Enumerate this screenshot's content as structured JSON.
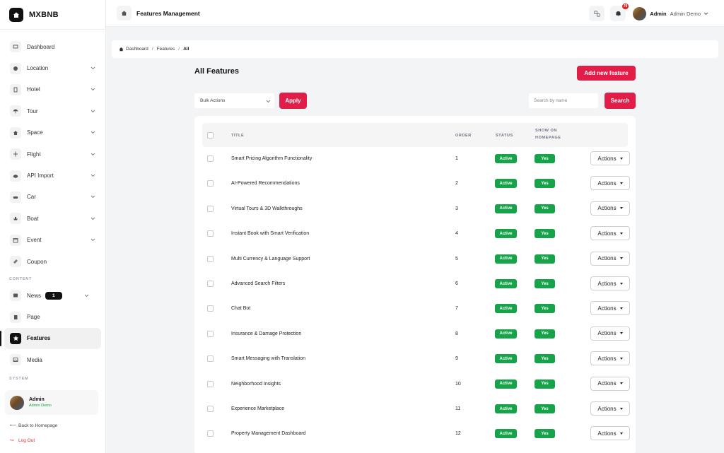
{
  "brand": {
    "name": "MXBNB"
  },
  "sidebar": {
    "items": [
      {
        "label": "Dashboard",
        "icon": "dashboard-icon",
        "has_submenu": false
      },
      {
        "label": "Location",
        "icon": "location-icon",
        "has_submenu": true
      },
      {
        "label": "Hotel",
        "icon": "hotel-icon",
        "has_submenu": true
      },
      {
        "label": "Tour",
        "icon": "tour-icon",
        "has_submenu": true
      },
      {
        "label": "Space",
        "icon": "space-icon",
        "has_submenu": true
      },
      {
        "label": "Flight",
        "icon": "flight-icon",
        "has_submenu": true
      },
      {
        "label": "API Import",
        "icon": "cloud-icon",
        "has_submenu": true
      },
      {
        "label": "Car",
        "icon": "car-icon",
        "has_submenu": true
      },
      {
        "label": "Boat",
        "icon": "boat-icon",
        "has_submenu": true
      },
      {
        "label": "Event",
        "icon": "event-icon",
        "has_submenu": true
      },
      {
        "label": "Coupon",
        "icon": "coupon-icon",
        "has_submenu": false
      }
    ],
    "content_section": "CONTENT",
    "content_items": [
      {
        "label": "News",
        "icon": "news-icon",
        "badge": "1",
        "has_submenu": true
      },
      {
        "label": "Page",
        "icon": "page-icon",
        "has_submenu": false
      },
      {
        "label": "Features",
        "icon": "star-icon",
        "has_submenu": false,
        "active": true
      },
      {
        "label": "Media",
        "icon": "media-icon",
        "has_submenu": false
      }
    ],
    "system_section": "SYSTEM",
    "user": {
      "name": "Admin",
      "role": "Admin Demo"
    },
    "back_link": "Back to Homepage",
    "logout_link": "Log Out"
  },
  "topbar": {
    "title": "Features Management",
    "notification_count": "79",
    "user_name": "Admin",
    "user_role": "Admin Demo"
  },
  "breadcrumb": {
    "home": "Dashboard",
    "section": "Features",
    "current": "All"
  },
  "main": {
    "title": "All Features",
    "add_button": "Add new feature",
    "bulk_select": "Bulk Actions",
    "apply_button": "Apply",
    "search_placeholder": "Search by name",
    "search_button": "Search"
  },
  "table": {
    "headers": {
      "title": "TITLE",
      "order": "ORDER",
      "status": "STATUS",
      "show_line1": "SHOW ON",
      "show_line2": "HOMEPAGE"
    },
    "action_label": "Actions",
    "rows": [
      {
        "title": "Smart Pricing Algorithm Functionality",
        "order": "1",
        "status": "Active",
        "homepage": "Yes"
      },
      {
        "title": "AI-Powered Recommendations",
        "order": "2",
        "status": "Active",
        "homepage": "Yes"
      },
      {
        "title": "Virtual Tours & 3D Walkthroughs",
        "order": "3",
        "status": "Active",
        "homepage": "Yes"
      },
      {
        "title": "Instant Book with Smart Verification",
        "order": "4",
        "status": "Active",
        "homepage": "Yes"
      },
      {
        "title": "Multi Currency & Language Support",
        "order": "5",
        "status": "Active",
        "homepage": "Yes"
      },
      {
        "title": "Advanced Search Filters",
        "order": "6",
        "status": "Active",
        "homepage": "Yes"
      },
      {
        "title": "Chat Bot",
        "order": "7",
        "status": "Active",
        "homepage": "Yes"
      },
      {
        "title": "Insurance & Damage Protection",
        "order": "8",
        "status": "Active",
        "homepage": "Yes"
      },
      {
        "title": "Smart Messaging with Translation",
        "order": "9",
        "status": "Active",
        "homepage": "Yes"
      },
      {
        "title": "Neighborhood Insights",
        "order": "10",
        "status": "Active",
        "homepage": "Yes"
      },
      {
        "title": "Experience Marketplace",
        "order": "11",
        "status": "Active",
        "homepage": "Yes"
      },
      {
        "title": "Property Management Dashboard",
        "order": "12",
        "status": "Active",
        "homepage": "Yes"
      }
    ]
  },
  "colors": {
    "accent": "#e11d48",
    "success": "#16a34a",
    "dark": "#111111"
  }
}
